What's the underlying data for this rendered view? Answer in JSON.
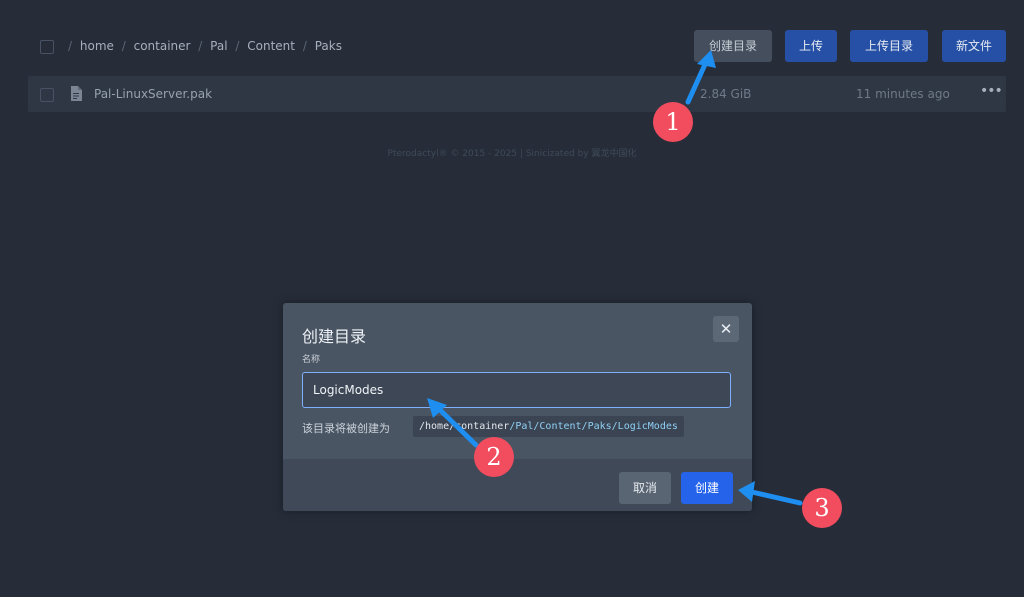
{
  "breadcrumb": {
    "root_sep": "/",
    "segments": [
      "home",
      "container",
      "Pal",
      "Content",
      "Paks"
    ],
    "separator": "/"
  },
  "toolbar": {
    "new_directory_label": "创建目录",
    "upload_label": "上传",
    "upload_directory_label": "上传目录",
    "new_file_label": "新文件"
  },
  "files": [
    {
      "name": "Pal-LinuxServer.pak",
      "size": "2.84 GiB",
      "modified": "11 minutes ago",
      "menu": "•••"
    }
  ],
  "footer": {
    "text": "Pterodactyl® © 2015 - 2025 | Sinicizated by 翼龙中国化"
  },
  "modal": {
    "title": "创建目录",
    "close_glyph": "✕",
    "name_label": "名称",
    "name_value": "LogicModes",
    "hint_prefix": "该目录将被创建为",
    "path_base": "/home/container",
    "path_highlight": "/Pal/Content/Paks/LogicModes",
    "cancel_label": "取消",
    "create_label": "创建"
  },
  "annotations": {
    "markers": [
      "1",
      "2",
      "3"
    ],
    "marker_color": "#f14d5f",
    "arrow_color": "#1e8ef0"
  },
  "colors": {
    "background": "#262d39",
    "primary_button": "#2650a6",
    "create_button": "#2563eb",
    "input_focus_border": "#7eb0ff"
  }
}
